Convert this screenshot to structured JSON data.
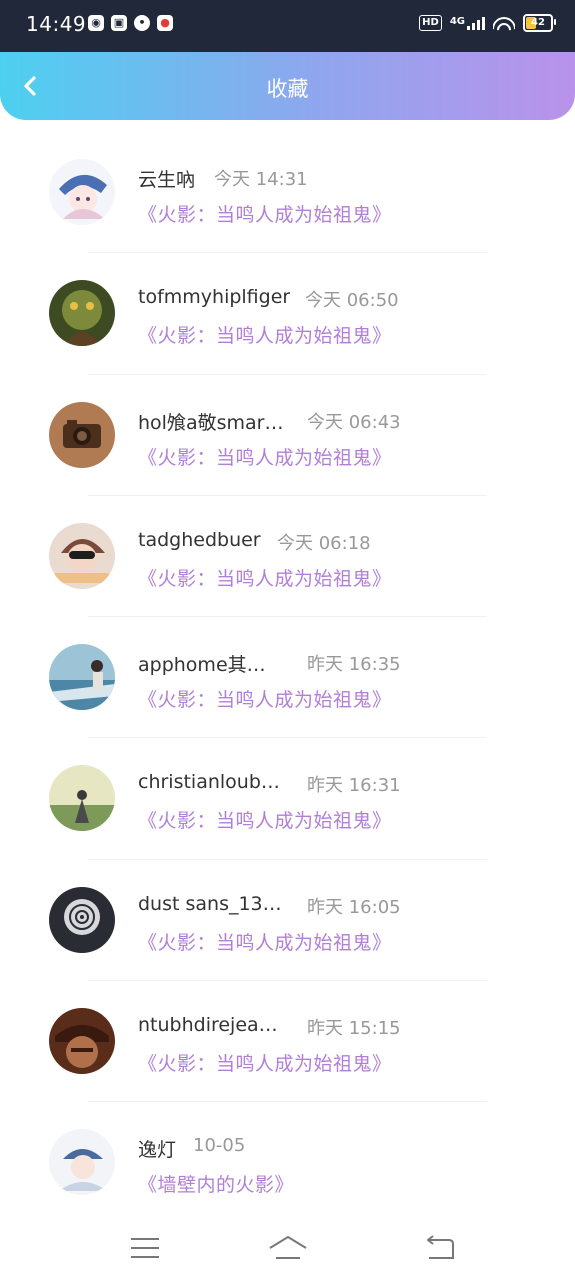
{
  "status_bar": {
    "time": "14:49",
    "hd": "HD",
    "network": "4G",
    "battery": "42"
  },
  "header": {
    "title": "收藏",
    "back_icon": "chevron-left-icon"
  },
  "favorites": [
    {
      "name": "云生吶",
      "time": "今天 14:31",
      "subject": "《火影：当鸣人成为始祖鬼》",
      "avatar_color": "#dfe6f5"
    },
    {
      "name": "tofmmyhiplfiger",
      "time": "今天 06:50",
      "subject": "《火影：当鸣人成为始祖鬼》",
      "avatar_color": "#5a6b32"
    },
    {
      "name": "hol飧a敬smar…",
      "time": "今天 06:43",
      "subject": "《火影：当鸣人成为始祖鬼》",
      "avatar_color": "#8a5a3a"
    },
    {
      "name": "tadghedbuer",
      "time": "今天 06:18",
      "subject": "《火影：当鸣人成为始祖鬼》",
      "avatar_color": "#d9c3b4"
    },
    {
      "name": "apphome其…",
      "time": "昨天 16:35",
      "subject": "《火影：当鸣人成为始祖鬼》",
      "avatar_color": "#6fa3bd"
    },
    {
      "name": "christianloub…",
      "time": "昨天 16:31",
      "subject": "《火影：当鸣人成为始祖鬼》",
      "avatar_color": "#cfd3a2"
    },
    {
      "name": "dust sans_13…",
      "time": "昨天 16:05",
      "subject": "《火影：当鸣人成为始祖鬼》",
      "avatar_color": "#3b3d47"
    },
    {
      "name": "ntubhdirejea…",
      "time": "昨天 15:15",
      "subject": "《火影：当鸣人成为始祖鬼》",
      "avatar_color": "#6b3b26"
    },
    {
      "name": "逸灯",
      "time": "10-05",
      "subject": "《墙壁内的火影》",
      "avatar_color": "#e9edf1"
    }
  ],
  "nav_bar": {
    "menu_icon": "menu-icon",
    "home_icon": "home-icon",
    "back_icon": "back-icon"
  }
}
